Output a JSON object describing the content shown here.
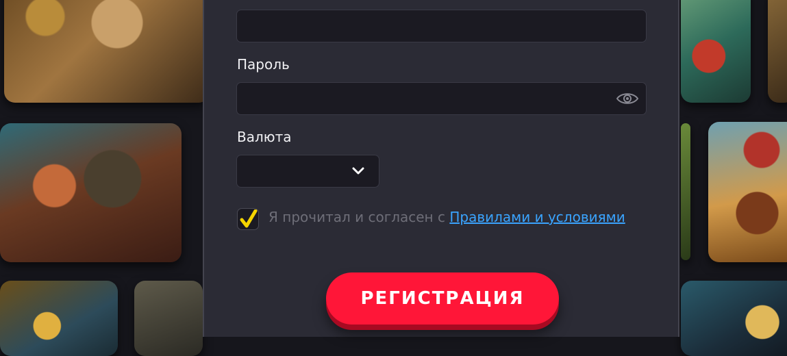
{
  "form": {
    "password_label": "Пароль",
    "currency_label": "Валюта",
    "currency_value": "",
    "terms_text": "Я прочитал и согласен с ",
    "terms_link": "Правилами и условиями",
    "terms_checked": true,
    "register_button": "РЕГИСТРАЦИЯ"
  },
  "icons": {
    "password_toggle": "eye-icon",
    "currency_dropdown": "chevron-down-icon",
    "checkbox": "checkmark-icon"
  },
  "colors": {
    "accent": "#ff1638",
    "checkmark": "#f5d400",
    "link": "#3aa4ff"
  }
}
